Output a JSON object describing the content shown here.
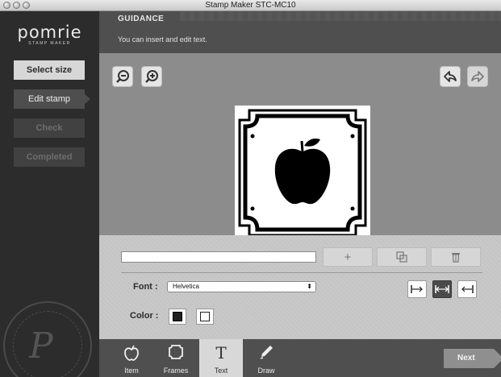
{
  "window": {
    "title": "Stamp Maker STC-MC10"
  },
  "sidebar": {
    "logo": {
      "word": "pomrie",
      "sub": "STAMP MAKER"
    },
    "steps": [
      {
        "label": "Select size",
        "state": "done"
      },
      {
        "label": "Edit stamp",
        "state": "active"
      },
      {
        "label": "Check",
        "state": "todo"
      },
      {
        "label": "Completed",
        "state": "todo"
      }
    ],
    "seal_text": "STAMP MAKER Pomrie"
  },
  "guidance": {
    "label": "GUIDANCE",
    "message": "You can insert and edit text."
  },
  "canvas": {
    "icons": [
      "zoom-out-icon",
      "zoom-in-icon",
      "undo-icon",
      "redo-icon"
    ],
    "stamp_content": "apple-icon"
  },
  "panel": {
    "text_value": "",
    "buttons": [
      "plus-icon",
      "duplicate-icon",
      "trash-icon"
    ],
    "font_label": "Font :",
    "font_value": "Helvetica",
    "color_label": "Color :",
    "align_icons": [
      "align-left-icon",
      "align-center-icon",
      "align-right-icon"
    ]
  },
  "toolbar": {
    "tools": [
      {
        "label": "Item",
        "icon": "apple-outline-icon"
      },
      {
        "label": "Frames",
        "icon": "frame-icon"
      },
      {
        "label": "Text",
        "icon": "text-icon"
      },
      {
        "label": "Draw",
        "icon": "pen-icon"
      }
    ],
    "next_label": "Next"
  }
}
